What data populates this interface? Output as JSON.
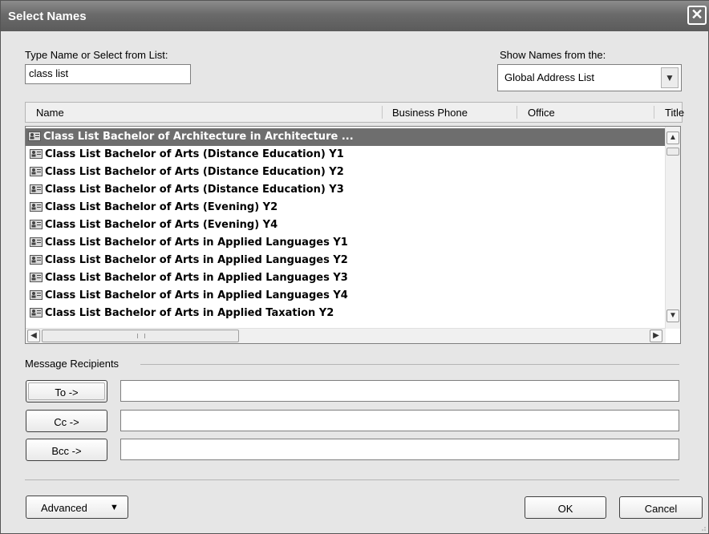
{
  "window": {
    "title": "Select Names",
    "close_glyph": "✕"
  },
  "search": {
    "label": "Type Name or Select from List:",
    "value": "class list"
  },
  "source": {
    "label": "Show Names from the:",
    "selected": "Global Address List"
  },
  "columns": {
    "name": "Name",
    "business_phone": "Business Phone",
    "office": "Office",
    "title": "Title"
  },
  "results": [
    "Class List Bachelor of Architecture in Architecture ...",
    "Class List Bachelor of Arts (Distance Education) Y1",
    "Class List Bachelor of Arts (Distance Education) Y2",
    "Class List Bachelor of Arts (Distance Education) Y3",
    "Class List Bachelor of Arts (Evening) Y2",
    "Class List Bachelor of Arts (Evening) Y4",
    "Class List Bachelor of Arts in Applied Languages Y1",
    "Class List Bachelor of Arts in Applied Languages Y2",
    "Class List Bachelor of Arts in Applied Languages Y3",
    "Class List Bachelor of Arts in Applied Languages Y4",
    "Class List Bachelor of Arts in Applied Taxation Y2"
  ],
  "selected_index": 0,
  "recipients": {
    "section_label": "Message Recipients",
    "to_label": "To ->",
    "cc_label": "Cc ->",
    "bcc_label": "Bcc ->",
    "to_value": "",
    "cc_value": "",
    "bcc_value": ""
  },
  "footer": {
    "advanced_label": "Advanced",
    "advanced_arrow": "▼",
    "ok_label": "OK",
    "cancel_label": "Cancel"
  },
  "icons": {
    "row_icon": "distribution-list-icon",
    "up_arrow": "▲",
    "down_arrow": "▼",
    "left_arrow": "◀",
    "right_arrow": "▶",
    "combo_arrow": "▼"
  },
  "colors": {
    "selection": "#6e6e6e",
    "titlebar": "#6a6a6a"
  }
}
